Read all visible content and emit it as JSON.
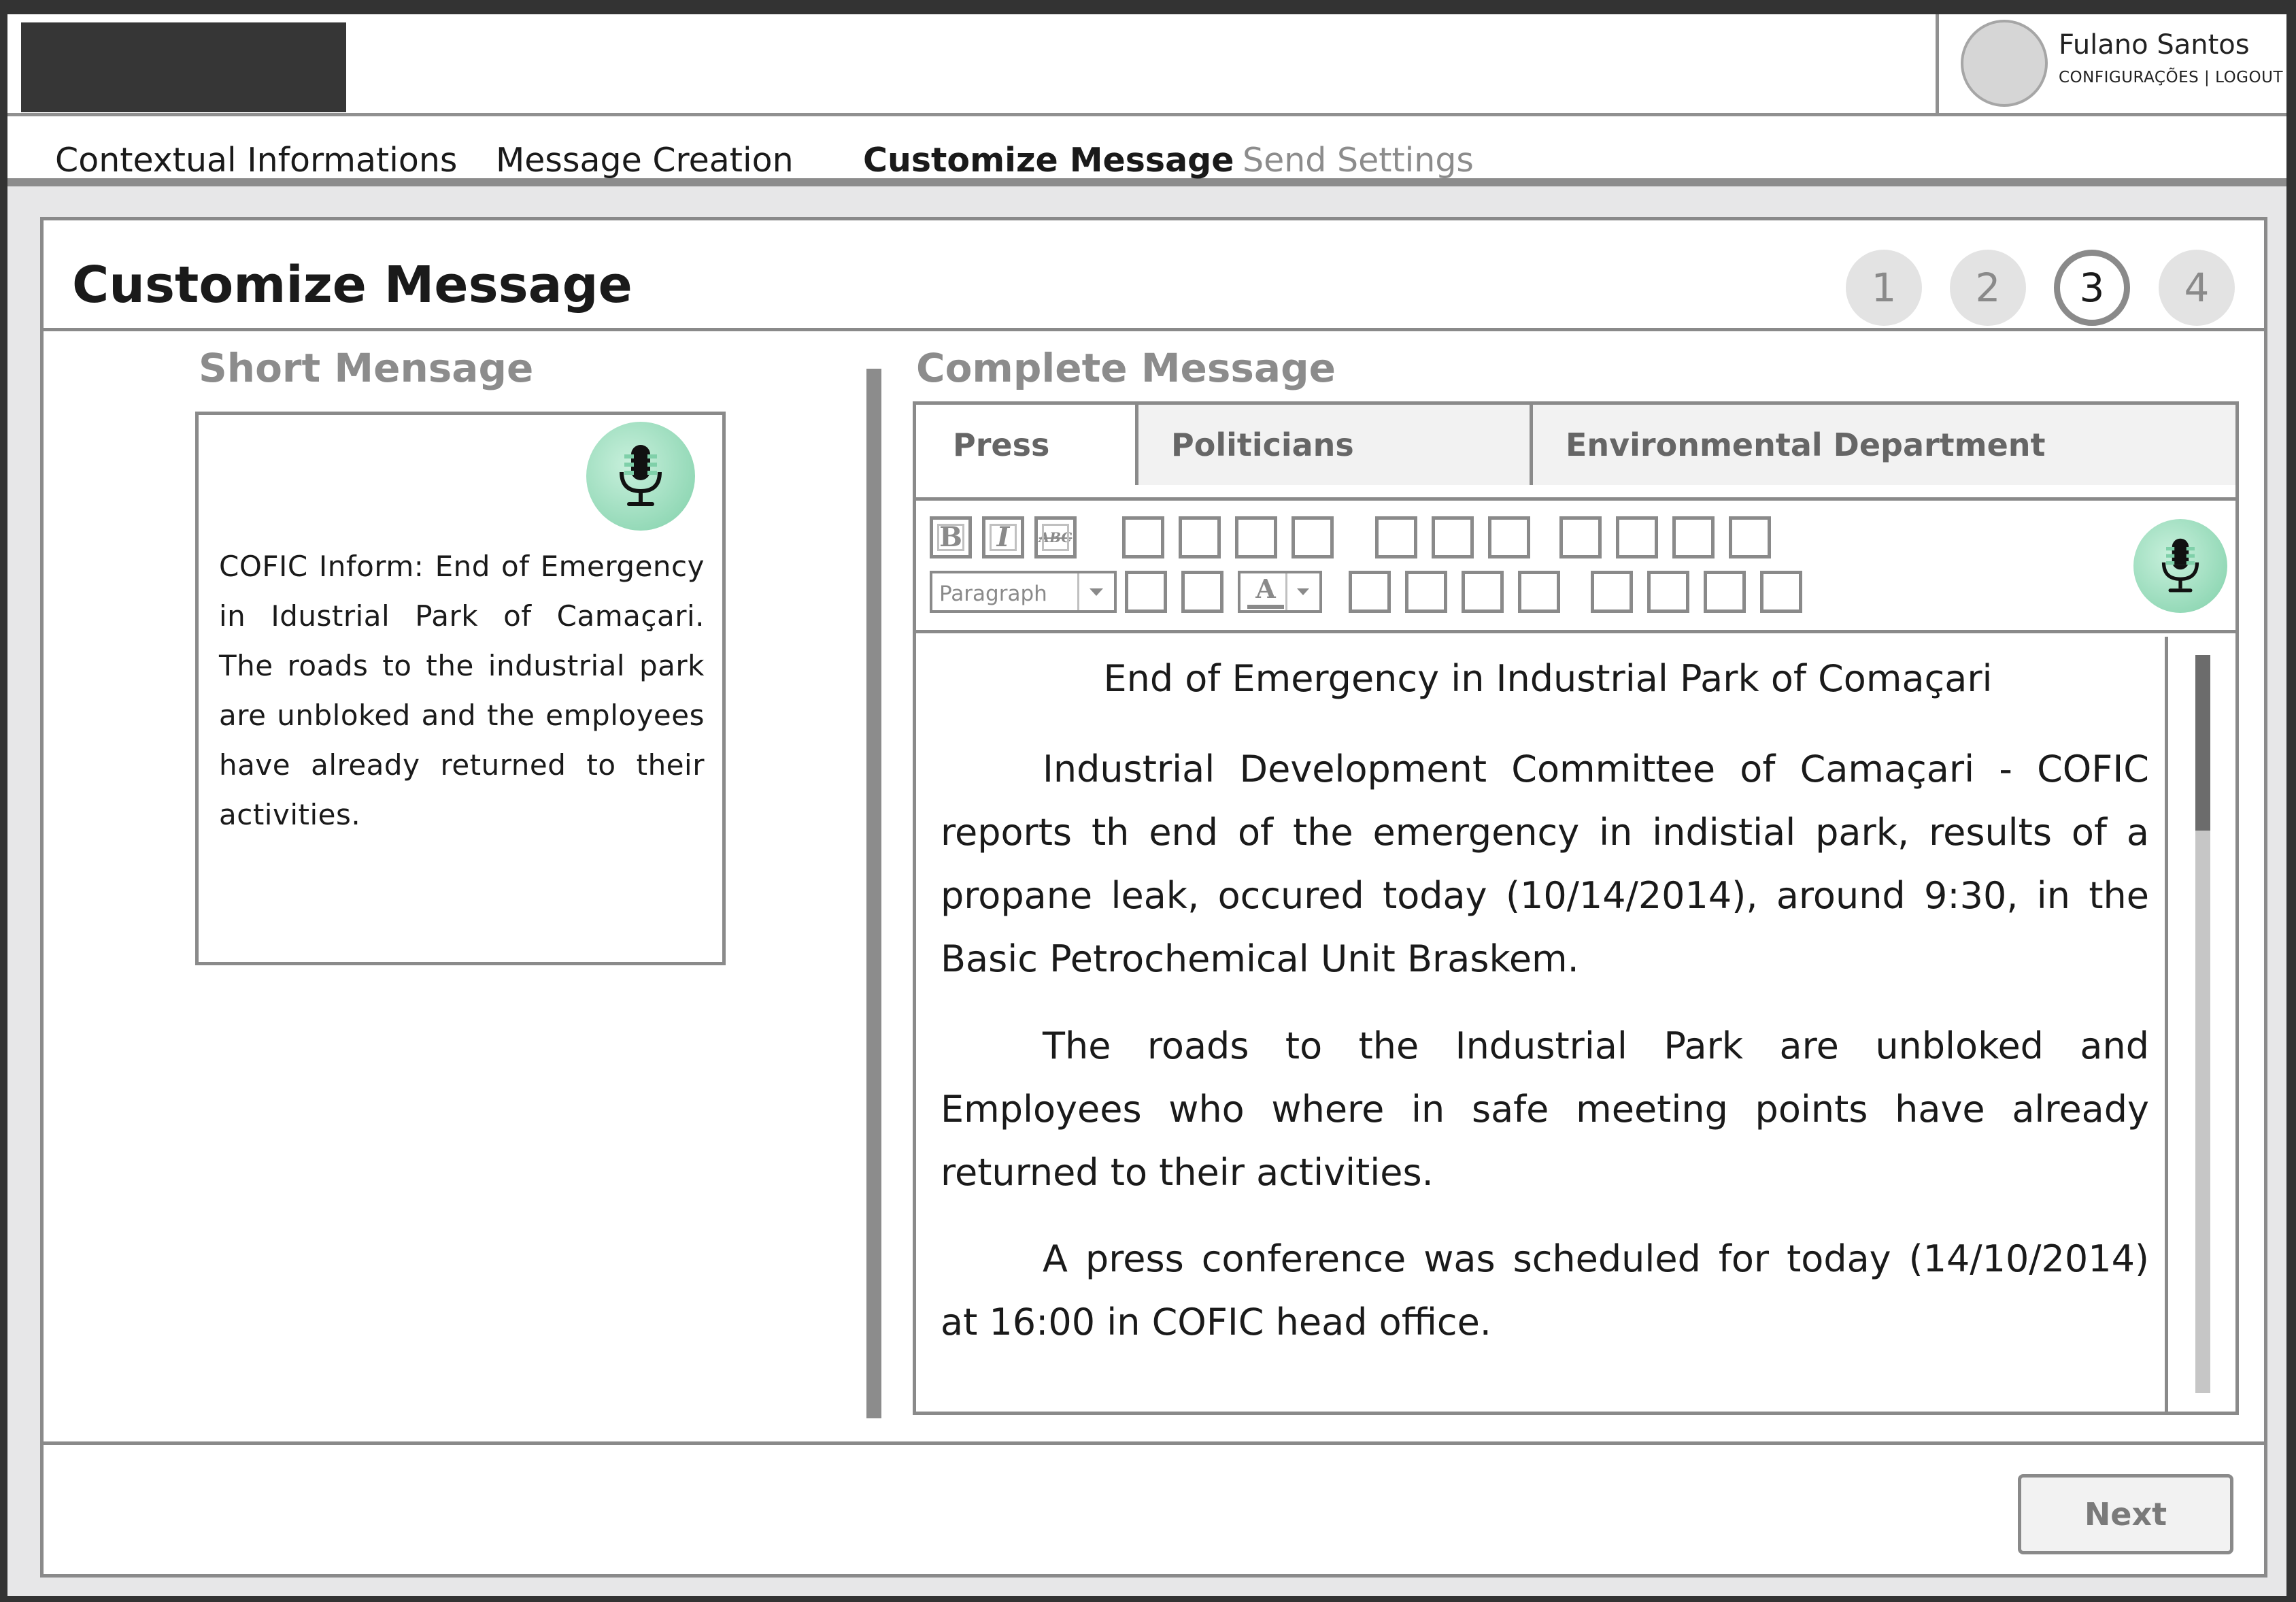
{
  "header": {
    "user_name": "Fulano Santos",
    "user_links": "CONFIGURAÇÕES | LOGOUT"
  },
  "nav": {
    "items": [
      {
        "label": "Contextual Informations",
        "state": "normal"
      },
      {
        "label": "Message Creation",
        "state": "normal"
      },
      {
        "label": "Customize Message",
        "state": "active"
      },
      {
        "label": "Send Settings",
        "state": "disabled"
      }
    ]
  },
  "page": {
    "title": "Customize Message",
    "steps": [
      "1",
      "2",
      "3",
      "4"
    ],
    "current_step": 3
  },
  "short_message": {
    "title": "Short Mensage",
    "text": "COFIC Inform: End of Emergency in Idustrial Park of Camaçari. The roads to the industrial park are unbloked  and the employees have already returned to their activities.",
    "mic_icon": "microphone-icon"
  },
  "complete_message": {
    "title": "Complete Message",
    "tabs": [
      "Press",
      "Politicians",
      "Environmental Department"
    ],
    "active_tab": "Press",
    "toolbar": {
      "bold": "B",
      "italic": "I",
      "strike": "ABC",
      "paragraph_select": "Paragraph",
      "font_color": "A"
    },
    "doc_title": "End of Emergency in Industrial Park of Comaçari",
    "paragraphs": [
      "Industrial Development Committee of Camaçari - COFIC reports th end of the emergency in indistial park, results of a propane leak, occured today (10/14/2014), around 9:30, in the Basic Petrochemical Unit Braskem.",
      "The roads to the Industrial Park are unbloked and Employees who where in safe meeting points have already returned to their activities.",
      "A press conference was scheduled for today (14/10/2014) at 16:00 in COFIC head office."
    ]
  },
  "footer": {
    "next_label": "Next"
  },
  "colors": {
    "mic_green": "#7fd0a9",
    "border_gray": "#8a8a8a",
    "frame_dark": "#333333"
  }
}
